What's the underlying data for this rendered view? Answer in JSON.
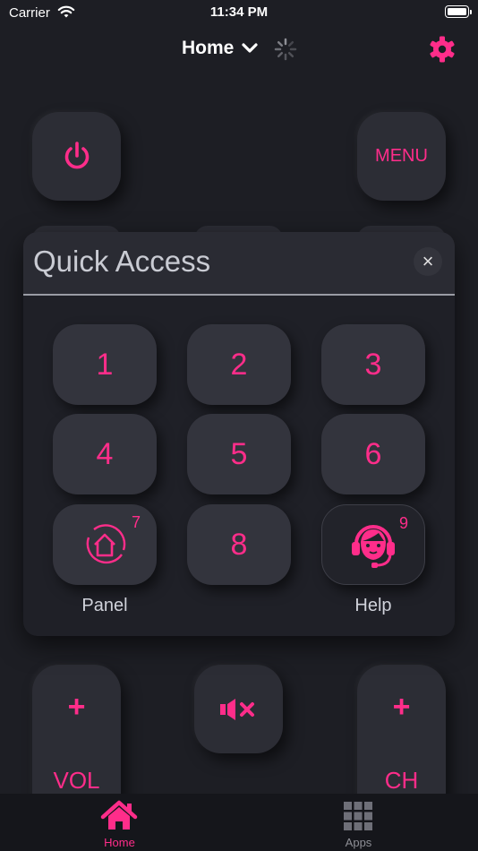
{
  "status_bar": {
    "carrier": "Carrier",
    "time": "11:34 PM"
  },
  "header": {
    "title": "Home"
  },
  "remote": {
    "menu_label": "MENU",
    "vol_label": "VOL",
    "ch_label": "CH",
    "plus_symbol": "+"
  },
  "quick_access": {
    "title": "Quick Access",
    "close_symbol": "×",
    "keys": [
      "1",
      "2",
      "3",
      "4",
      "5",
      "6",
      "8"
    ],
    "panel_label": "Panel",
    "panel_number": "7",
    "help_label": "Help",
    "help_number": "9"
  },
  "tab_bar": {
    "tabs": [
      {
        "label": "Home",
        "icon": "house-icon",
        "active": true
      },
      {
        "label": "Apps",
        "icon": "grid-icon",
        "active": false
      }
    ]
  },
  "colors": {
    "accent": "#ff2d8a",
    "background": "#1d1e24",
    "button": "#2c2d35"
  }
}
